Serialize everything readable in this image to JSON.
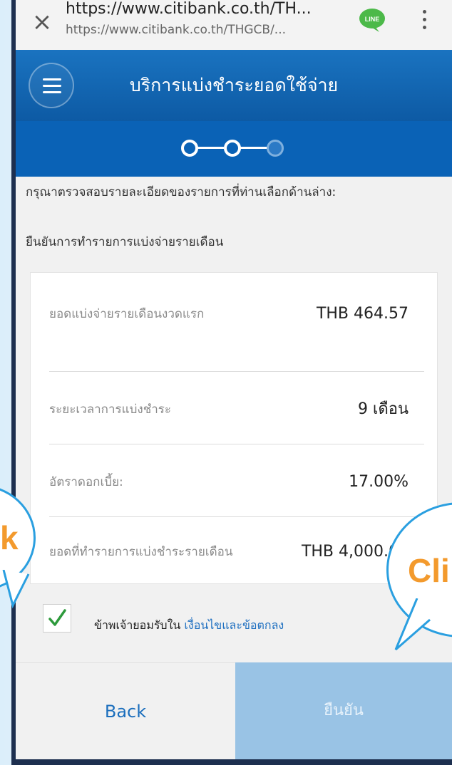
{
  "browser": {
    "url_title": "https://www.citibank.co.th/TH...",
    "url_sub": "https://www.citibank.co.th/THGCB/...",
    "line_icon_label": "LINE"
  },
  "header": {
    "title": "บริการแบ่งชำระยอดใช้จ่าย"
  },
  "instruction": "กรุณาตรวจสอบรายละเอียดของรายการที่ท่านเลือกด้านล่าง:",
  "confirm_title": "ยืนยันการทำรายการแบ่งจ่ายรายเดือน",
  "details": [
    {
      "label": "ยอดแบ่งจ่ายรายเดือนงวดแรก",
      "value": "THB 464.57"
    },
    {
      "label": "ระยะเวลาการแบ่งชำระ",
      "value": "9 เดือน"
    },
    {
      "label": "อัตราดอกเบี้ย:",
      "value": "17.00%"
    },
    {
      "label": "ยอดที่ทำรายการแบ่งชำระรายเดือน",
      "value": "THB 4,000.00"
    }
  ],
  "terms": {
    "prefix": "ข้าพเจ้ายอมรับใน",
    "link": "เงื่อนไขและข้อตกลง",
    "checked": true
  },
  "buttons": {
    "back": "Back",
    "confirm": "ยืนยัน"
  },
  "callouts": {
    "left": "k",
    "right": "Cli"
  },
  "colors": {
    "brand_blue": "#0d5aa4",
    "link_blue": "#1e6fc0",
    "confirm_disabled": "#99c3e5",
    "checkmark_green": "#2e9a3c",
    "callout_text": "#f39a2d",
    "callout_border": "#2a9fe0"
  },
  "steps": {
    "completed": 2,
    "current": 3,
    "total": 3
  }
}
